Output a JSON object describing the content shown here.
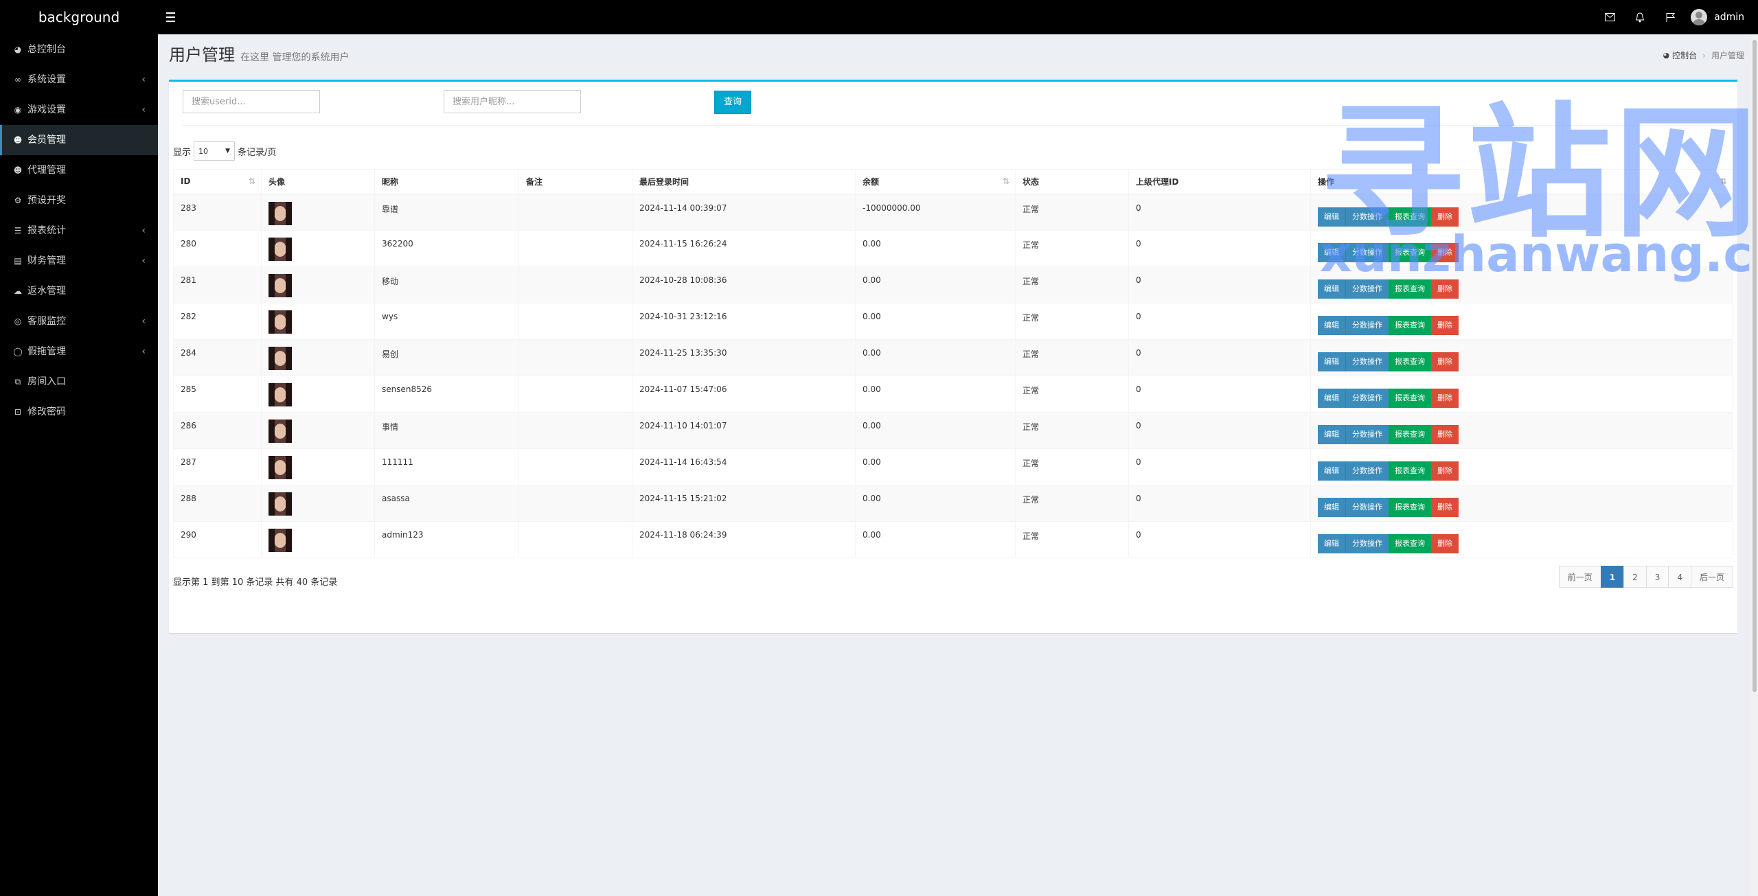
{
  "header": {
    "brand": "background",
    "user_name": "admin",
    "icons": [
      "mail-icon",
      "bell-icon",
      "flag-icon"
    ]
  },
  "sidebar": {
    "items": [
      {
        "label": "总控制台",
        "icon": "dashboard-icon",
        "caret": false,
        "active": false
      },
      {
        "label": "系统设置",
        "icon": "link-icon",
        "caret": true,
        "active": false
      },
      {
        "label": "游戏设置",
        "icon": "gamepad-icon",
        "caret": true,
        "active": false
      },
      {
        "label": "会员管理",
        "icon": "users-icon",
        "caret": false,
        "active": true
      },
      {
        "label": "代理管理",
        "icon": "users-icon",
        "caret": false,
        "active": false
      },
      {
        "label": "预设开奖",
        "icon": "sliders-icon",
        "caret": false,
        "active": false
      },
      {
        "label": "报表统计",
        "icon": "list-icon",
        "caret": true,
        "active": false
      },
      {
        "label": "财务管理",
        "icon": "database-icon",
        "caret": true,
        "active": false
      },
      {
        "label": "返水管理",
        "icon": "cloud-icon",
        "caret": false,
        "active": false
      },
      {
        "label": "客服监控",
        "icon": "eye-icon",
        "caret": true,
        "active": false
      },
      {
        "label": "假拖管理",
        "icon": "chat-icon",
        "caret": true,
        "active": false
      },
      {
        "label": "房间入口",
        "icon": "external-icon",
        "caret": false,
        "active": false
      },
      {
        "label": "修改密码",
        "icon": "cart-icon",
        "caret": false,
        "active": false
      }
    ]
  },
  "page": {
    "title": "用户管理",
    "subtitle": "在这里 管理您的系统用户",
    "breadcrumb_home": "控制台",
    "breadcrumb_current": "用户管理"
  },
  "search": {
    "userid_placeholder": "搜索userid...",
    "nickname_placeholder": "搜索用户昵称...",
    "query_label": "查询"
  },
  "length": {
    "prefix": "显示",
    "value": "10",
    "suffix": "条记录/页"
  },
  "table": {
    "columns": [
      "ID",
      "头像",
      "昵称",
      "备注",
      "最后登录时间",
      "余额",
      "状态",
      "上级代理ID",
      "操作"
    ],
    "rows": [
      {
        "id": "283",
        "nickname": "靠谱",
        "note": "",
        "last_login": "2024-11-14 00:39:07",
        "balance": "-10000000.00",
        "status": "正常",
        "parent_id": "0"
      },
      {
        "id": "280",
        "nickname": "362200",
        "note": "",
        "last_login": "2024-11-15 16:26:24",
        "balance": "0.00",
        "status": "正常",
        "parent_id": "0"
      },
      {
        "id": "281",
        "nickname": "移动",
        "note": "",
        "last_login": "2024-10-28 10:08:36",
        "balance": "0.00",
        "status": "正常",
        "parent_id": "0"
      },
      {
        "id": "282",
        "nickname": "wys",
        "note": "",
        "last_login": "2024-10-31 23:12:16",
        "balance": "0.00",
        "status": "正常",
        "parent_id": "0"
      },
      {
        "id": "284",
        "nickname": "易创",
        "note": "",
        "last_login": "2024-11-25 13:35:30",
        "balance": "0.00",
        "status": "正常",
        "parent_id": "0"
      },
      {
        "id": "285",
        "nickname": "sensen8526",
        "note": "",
        "last_login": "2024-11-07 15:47:06",
        "balance": "0.00",
        "status": "正常",
        "parent_id": "0"
      },
      {
        "id": "286",
        "nickname": "事情",
        "note": "",
        "last_login": "2024-11-10 14:01:07",
        "balance": "0.00",
        "status": "正常",
        "parent_id": "0"
      },
      {
        "id": "287",
        "nickname": "111111",
        "note": "",
        "last_login": "2024-11-14 16:43:54",
        "balance": "0.00",
        "status": "正常",
        "parent_id": "0"
      },
      {
        "id": "288",
        "nickname": "asassa",
        "note": "",
        "last_login": "2024-11-15 15:21:02",
        "balance": "0.00",
        "status": "正常",
        "parent_id": "0"
      },
      {
        "id": "290",
        "nickname": "admin123",
        "note": "",
        "last_login": "2024-11-18 06:24:39",
        "balance": "0.00",
        "status": "正常",
        "parent_id": "0"
      }
    ],
    "actions": {
      "edit": "编辑",
      "split": "分数操作",
      "report": "报表查询",
      "delete": "删除"
    }
  },
  "footer": {
    "info": "显示第 1 到第 10 条记录 共有 40 条记录",
    "prev": "前一页",
    "next": "后一页",
    "pages": [
      "1",
      "2",
      "3",
      "4"
    ],
    "current_page": "1"
  },
  "watermark": {
    "cn": "寻站网",
    "en": "xunzhanwang.com"
  },
  "colors": {
    "accent": "#00c0ef",
    "primary": "#3c8dbc",
    "success": "#00a65a",
    "danger": "#dd4b39"
  }
}
